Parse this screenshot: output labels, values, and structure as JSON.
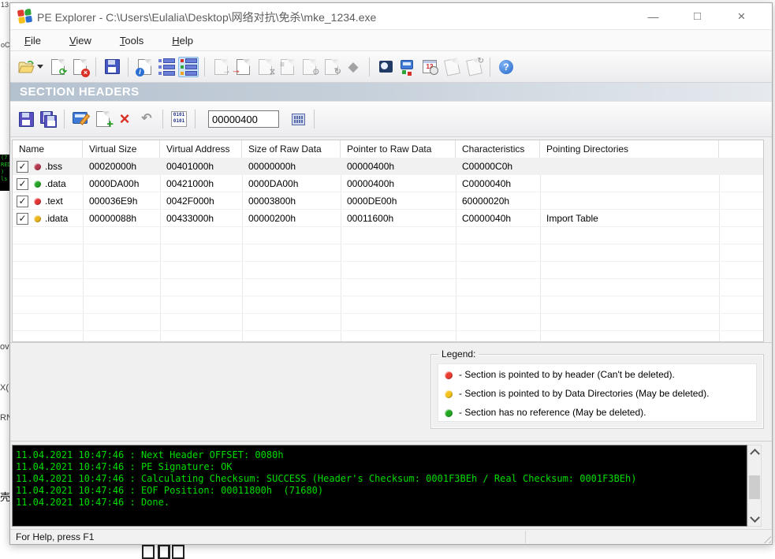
{
  "window": {
    "title": "PE Explorer - C:\\Users\\Eulalia\\Desktop\\网络对抗\\免杀\\mke_1234.exe",
    "controls": {
      "minimize": "—",
      "maximize": "□",
      "close": "×"
    }
  },
  "menu": {
    "items": [
      "File",
      "View",
      "Tools",
      "Help"
    ]
  },
  "toolbar_main": {
    "buttons": [
      "open-file",
      "open-file-dropdown",
      "reload-file",
      "close-file",
      "save-file",
      "file-info",
      "headers-view",
      "section-headers-view",
      "export-data",
      "import-data",
      "exclude-data",
      "resource-view",
      "apply-changes",
      "update-view",
      "split-view",
      "disassembler",
      "dependency-scanner",
      "time-date-stamps",
      "digital-signature",
      "verify-signature",
      "help"
    ]
  },
  "banner": {
    "title": "SECTION HEADERS"
  },
  "section_toolbar": {
    "buttons": [
      "save-section",
      "save-all-sections",
      "edit-section",
      "add-section",
      "delete-section",
      "undo",
      "binary-view",
      "calculator"
    ],
    "offset_value": "00000400",
    "binary_glyph_top": "0101",
    "binary_glyph_bottom": "0101"
  },
  "icons": {
    "check": "✓",
    "undo": "↶",
    "delete": "×",
    "reload": "⟳",
    "info": "i",
    "help": "?",
    "arrow": "→"
  },
  "table": {
    "columns": [
      "Name",
      "Virtual Size",
      "Virtual Address",
      "Size of Raw Data",
      "Pointer to Raw Data",
      "Characteristics",
      "Pointing Directories"
    ],
    "rows": [
      {
        "checked": true,
        "selected": true,
        "dot": "#b5394f",
        "name": ".bss",
        "virtual_size": "00020000h",
        "virtual_address": "00401000h",
        "size_of_raw_data": "00000000h",
        "pointer_to_raw_data": "00000400h",
        "characteristics": "C00000C0h",
        "pointing_directories": ""
      },
      {
        "checked": true,
        "selected": false,
        "dot": "#27a527",
        "name": ".data",
        "virtual_size": "0000DA00h",
        "virtual_address": "00421000h",
        "size_of_raw_data": "0000DA00h",
        "pointer_to_raw_data": "00000400h",
        "characteristics": "C0000040h",
        "pointing_directories": ""
      },
      {
        "checked": true,
        "selected": false,
        "dot": "#e43535",
        "name": ".text",
        "virtual_size": "000036E9h",
        "virtual_address": "0042F000h",
        "size_of_raw_data": "00003800h",
        "pointer_to_raw_data": "0000DE00h",
        "characteristics": "60000020h",
        "pointing_directories": ""
      },
      {
        "checked": true,
        "selected": false,
        "dot": "#eab61e",
        "name": ".idata",
        "virtual_size": "00000088h",
        "virtual_address": "00433000h",
        "size_of_raw_data": "00000200h",
        "pointer_to_raw_data": "00011600h",
        "characteristics": "C0000040h",
        "pointing_directories": "Import Table"
      }
    ]
  },
  "legend": {
    "title": "Legend:",
    "items": [
      {
        "color": "#ea3c32",
        "text": "- Section is pointed to by header (Can't be deleted)."
      },
      {
        "color": "#f3c31b",
        "text": "- Section is pointed to by Data Directories (May be deleted)."
      },
      {
        "color": "#22a822",
        "text": "- Section has no reference (May be deleted)."
      }
    ]
  },
  "console": {
    "lines": [
      "11.04.2021 10:47:46 : Next Header OFFSET: 0080h",
      "11.04.2021 10:47:46 : PE Signature: OK",
      "11.04.2021 10:47:46 : Calculating Checksum: SUCCESS (Header's Checksum: 0001F3BEh / Real Checksum: 0001F3BEh)",
      "11.04.2021 10:47:46 : EOF Position: 00011800h  (71680)",
      "11.04.2021 10:47:46 : Done."
    ]
  },
  "status_bar": {
    "help_text": "For Help, press F1"
  },
  "background_fragments": {
    "top": "13",
    "t2": "oC",
    "console_lines": [
      "(7",
      "RED",
      ")",
      "ls"
    ],
    "m1": "ov",
    "m2": "X(",
    "m3": "RN",
    "m4": "壳"
  }
}
